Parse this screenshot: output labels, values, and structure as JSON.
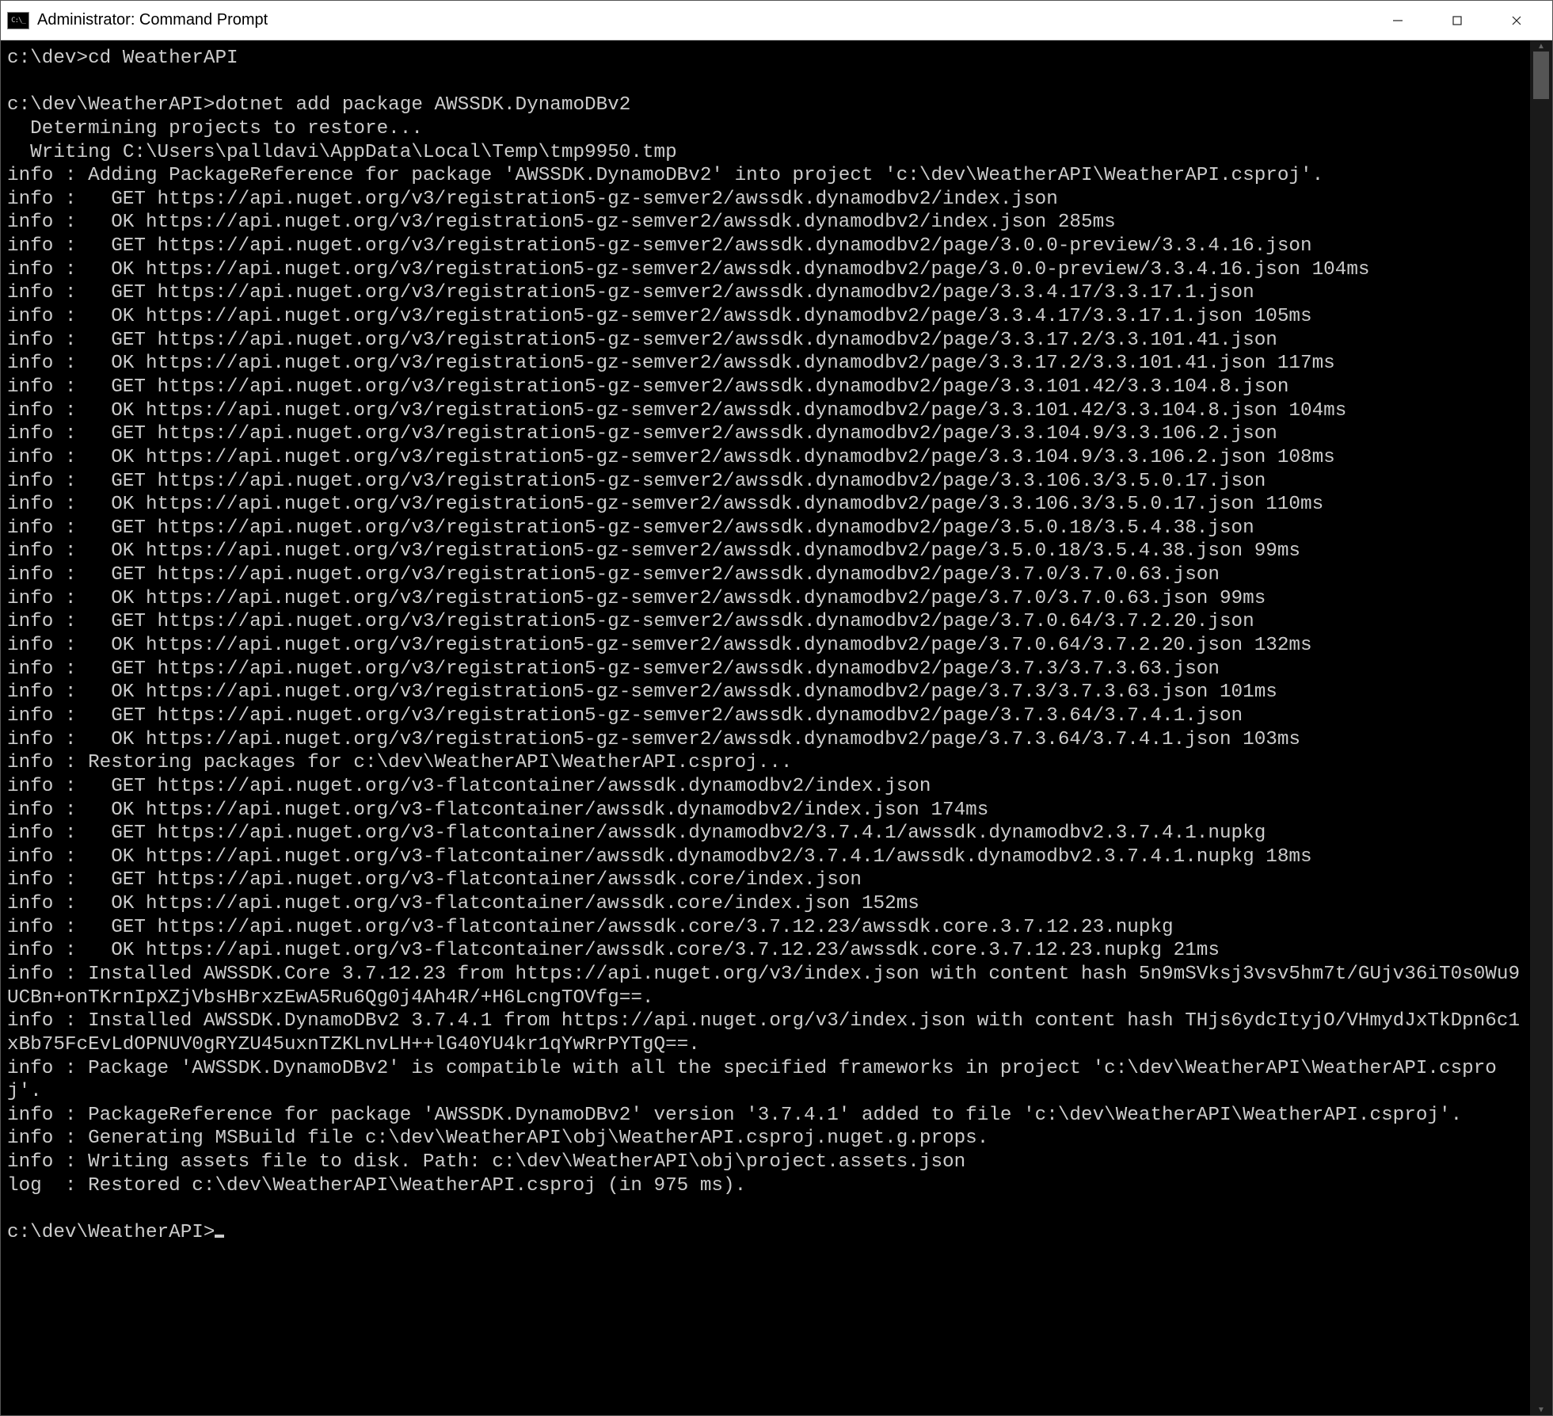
{
  "window": {
    "title": "Administrator: Command Prompt"
  },
  "terminal": {
    "lines": [
      "c:\\dev>cd WeatherAPI",
      "",
      "c:\\dev\\WeatherAPI>dotnet add package AWSSDK.DynamoDBv2",
      "  Determining projects to restore...",
      "  Writing C:\\Users\\palldavi\\AppData\\Local\\Temp\\tmp9950.tmp",
      "info : Adding PackageReference for package 'AWSSDK.DynamoDBv2' into project 'c:\\dev\\WeatherAPI\\WeatherAPI.csproj'.",
      "info :   GET https://api.nuget.org/v3/registration5-gz-semver2/awssdk.dynamodbv2/index.json",
      "info :   OK https://api.nuget.org/v3/registration5-gz-semver2/awssdk.dynamodbv2/index.json 285ms",
      "info :   GET https://api.nuget.org/v3/registration5-gz-semver2/awssdk.dynamodbv2/page/3.0.0-preview/3.3.4.16.json",
      "info :   OK https://api.nuget.org/v3/registration5-gz-semver2/awssdk.dynamodbv2/page/3.0.0-preview/3.3.4.16.json 104ms",
      "info :   GET https://api.nuget.org/v3/registration5-gz-semver2/awssdk.dynamodbv2/page/3.3.4.17/3.3.17.1.json",
      "info :   OK https://api.nuget.org/v3/registration5-gz-semver2/awssdk.dynamodbv2/page/3.3.4.17/3.3.17.1.json 105ms",
      "info :   GET https://api.nuget.org/v3/registration5-gz-semver2/awssdk.dynamodbv2/page/3.3.17.2/3.3.101.41.json",
      "info :   OK https://api.nuget.org/v3/registration5-gz-semver2/awssdk.dynamodbv2/page/3.3.17.2/3.3.101.41.json 117ms",
      "info :   GET https://api.nuget.org/v3/registration5-gz-semver2/awssdk.dynamodbv2/page/3.3.101.42/3.3.104.8.json",
      "info :   OK https://api.nuget.org/v3/registration5-gz-semver2/awssdk.dynamodbv2/page/3.3.101.42/3.3.104.8.json 104ms",
      "info :   GET https://api.nuget.org/v3/registration5-gz-semver2/awssdk.dynamodbv2/page/3.3.104.9/3.3.106.2.json",
      "info :   OK https://api.nuget.org/v3/registration5-gz-semver2/awssdk.dynamodbv2/page/3.3.104.9/3.3.106.2.json 108ms",
      "info :   GET https://api.nuget.org/v3/registration5-gz-semver2/awssdk.dynamodbv2/page/3.3.106.3/3.5.0.17.json",
      "info :   OK https://api.nuget.org/v3/registration5-gz-semver2/awssdk.dynamodbv2/page/3.3.106.3/3.5.0.17.json 110ms",
      "info :   GET https://api.nuget.org/v3/registration5-gz-semver2/awssdk.dynamodbv2/page/3.5.0.18/3.5.4.38.json",
      "info :   OK https://api.nuget.org/v3/registration5-gz-semver2/awssdk.dynamodbv2/page/3.5.0.18/3.5.4.38.json 99ms",
      "info :   GET https://api.nuget.org/v3/registration5-gz-semver2/awssdk.dynamodbv2/page/3.7.0/3.7.0.63.json",
      "info :   OK https://api.nuget.org/v3/registration5-gz-semver2/awssdk.dynamodbv2/page/3.7.0/3.7.0.63.json 99ms",
      "info :   GET https://api.nuget.org/v3/registration5-gz-semver2/awssdk.dynamodbv2/page/3.7.0.64/3.7.2.20.json",
      "info :   OK https://api.nuget.org/v3/registration5-gz-semver2/awssdk.dynamodbv2/page/3.7.0.64/3.7.2.20.json 132ms",
      "info :   GET https://api.nuget.org/v3/registration5-gz-semver2/awssdk.dynamodbv2/page/3.7.3/3.7.3.63.json",
      "info :   OK https://api.nuget.org/v3/registration5-gz-semver2/awssdk.dynamodbv2/page/3.7.3/3.7.3.63.json 101ms",
      "info :   GET https://api.nuget.org/v3/registration5-gz-semver2/awssdk.dynamodbv2/page/3.7.3.64/3.7.4.1.json",
      "info :   OK https://api.nuget.org/v3/registration5-gz-semver2/awssdk.dynamodbv2/page/3.7.3.64/3.7.4.1.json 103ms",
      "info : Restoring packages for c:\\dev\\WeatherAPI\\WeatherAPI.csproj...",
      "info :   GET https://api.nuget.org/v3-flatcontainer/awssdk.dynamodbv2/index.json",
      "info :   OK https://api.nuget.org/v3-flatcontainer/awssdk.dynamodbv2/index.json 174ms",
      "info :   GET https://api.nuget.org/v3-flatcontainer/awssdk.dynamodbv2/3.7.4.1/awssdk.dynamodbv2.3.7.4.1.nupkg",
      "info :   OK https://api.nuget.org/v3-flatcontainer/awssdk.dynamodbv2/3.7.4.1/awssdk.dynamodbv2.3.7.4.1.nupkg 18ms",
      "info :   GET https://api.nuget.org/v3-flatcontainer/awssdk.core/index.json",
      "info :   OK https://api.nuget.org/v3-flatcontainer/awssdk.core/index.json 152ms",
      "info :   GET https://api.nuget.org/v3-flatcontainer/awssdk.core/3.7.12.23/awssdk.core.3.7.12.23.nupkg",
      "info :   OK https://api.nuget.org/v3-flatcontainer/awssdk.core/3.7.12.23/awssdk.core.3.7.12.23.nupkg 21ms",
      "info : Installed AWSSDK.Core 3.7.12.23 from https://api.nuget.org/v3/index.json with content hash 5n9mSVksj3vsv5hm7t/GUjv36iT0s0Wu9UCBn+onTKrnIpXZjVbsHBrxzEwA5Ru6Qg0j4Ah4R/+H6LcngTOVfg==.",
      "info : Installed AWSSDK.DynamoDBv2 3.7.4.1 from https://api.nuget.org/v3/index.json with content hash THjs6ydcItyjO/VHmydJxTkDpn6c1xBb75FcEvLdOPNUV0gRYZU45uxnTZKLnvLH++lG40YU4kr1qYwRrPYTgQ==.",
      "info : Package 'AWSSDK.DynamoDBv2' is compatible with all the specified frameworks in project 'c:\\dev\\WeatherAPI\\WeatherAPI.csproj'.",
      "info : PackageReference for package 'AWSSDK.DynamoDBv2' version '3.7.4.1' added to file 'c:\\dev\\WeatherAPI\\WeatherAPI.csproj'.",
      "info : Generating MSBuild file c:\\dev\\WeatherAPI\\obj\\WeatherAPI.csproj.nuget.g.props.",
      "info : Writing assets file to disk. Path: c:\\dev\\WeatherAPI\\obj\\project.assets.json",
      "log  : Restored c:\\dev\\WeatherAPI\\WeatherAPI.csproj (in 975 ms).",
      ""
    ],
    "prompt": "c:\\dev\\WeatherAPI>"
  }
}
